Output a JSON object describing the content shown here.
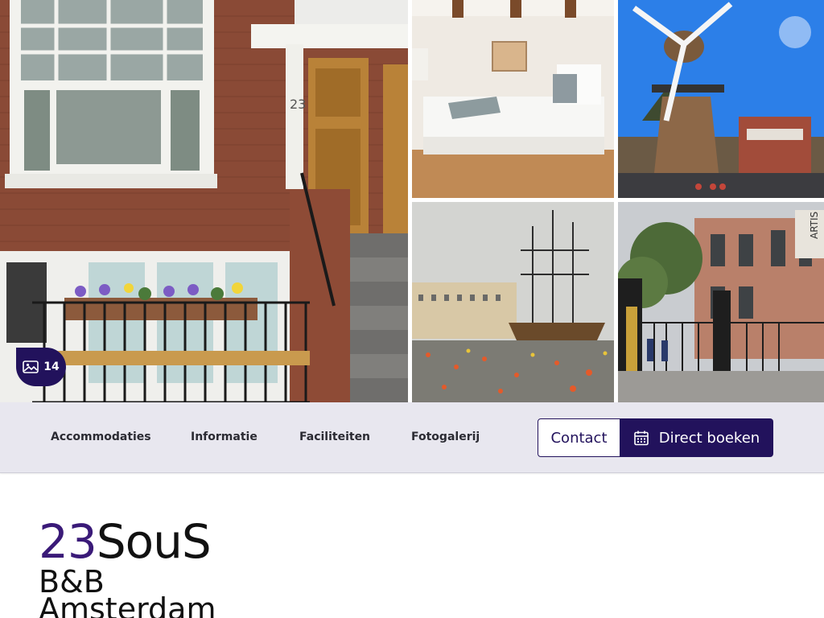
{
  "gallery": {
    "photo_count": "14",
    "photos": [
      {
        "name": "house-front"
      },
      {
        "name": "bedroom"
      },
      {
        "name": "windmill"
      },
      {
        "name": "tall-ship"
      },
      {
        "name": "artis-zoo-gate"
      }
    ]
  },
  "nav": {
    "items": [
      {
        "label": "Accommodaties"
      },
      {
        "label": "Informatie"
      },
      {
        "label": "Faciliteiten"
      },
      {
        "label": "Fotogalerij"
      }
    ],
    "contact_label": "Contact",
    "book_label": "Direct boeken"
  },
  "logo": {
    "number": "23",
    "name": "SouS",
    "line2": "B&B",
    "line3": "Amsterdam"
  },
  "colors": {
    "accent": "#22125c",
    "nav_bg": "#e8e7ef",
    "logo_number": "#3a1a78"
  },
  "icons": {
    "photo_count": "image-icon",
    "book": "calendar-icon"
  }
}
